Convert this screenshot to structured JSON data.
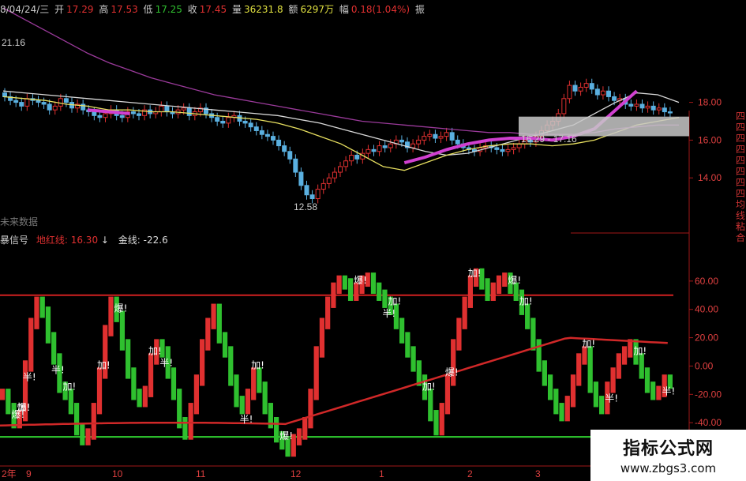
{
  "header": {
    "date": "8/04/24/三",
    "open_label": "开",
    "open": "17.29",
    "high_label": "高",
    "high": "17.53",
    "low_label": "低",
    "low": "17.25",
    "close_label": "收",
    "close": "17.45",
    "vol_label": "量",
    "vol": "36231.8",
    "amt_label": "额",
    "amt": "6297万",
    "chg_label": "幅",
    "chg": "0.18(1.04%)",
    "tail": "振"
  },
  "upper_panel": {
    "price_ticks": [
      "18.00",
      "16.00",
      "14.00"
    ],
    "label_max": "21.16",
    "label_min": "12.58",
    "zone_label": "16.29 - 17.16",
    "future_label": "未来数据"
  },
  "indicator_panel": {
    "name": "暴信号",
    "line1_label": "地红线:",
    "line1_value": "16.30",
    "line1_arrow": "↓",
    "line2_label": "金线:",
    "line2_value": "-22.6",
    "ticks": [
      "60.00",
      "40.00",
      "20.00",
      "0.00",
      "-20.00",
      "-40.00",
      "-60.00"
    ],
    "markers": [
      {
        "text": "爆",
        "x": 3
      },
      {
        "text": "爆",
        "x": 4
      },
      {
        "text": "加",
        "x": 4.8
      },
      {
        "text": "半",
        "x": 6
      },
      {
        "text": "半",
        "x": 13
      },
      {
        "text": "加",
        "x": 16
      },
      {
        "text": "加",
        "x": 25
      },
      {
        "text": "爆",
        "x": 29
      },
      {
        "text": "加",
        "x": 38
      },
      {
        "text": "半",
        "x": 40
      },
      {
        "text": "半",
        "x": 60
      },
      {
        "text": "加",
        "x": 63
      },
      {
        "text": "爆",
        "x": 70
      },
      {
        "text": "爆",
        "x": 90
      },
      {
        "text": "加",
        "x": 98
      },
      {
        "text": "半",
        "x": 97
      },
      {
        "text": "加",
        "x": 107
      },
      {
        "text": "加",
        "x": 118
      },
      {
        "text": "爆",
        "x": 112
      },
      {
        "text": "爆",
        "x": 128
      },
      {
        "text": "加",
        "x": 131
      },
      {
        "text": "加",
        "x": 147
      },
      {
        "text": "半",
        "x": 153
      },
      {
        "text": "加",
        "x": 160
      },
      {
        "text": "半",
        "x": 167
      }
    ]
  },
  "xaxis": {
    "labels": [
      "2年",
      "9",
      "10",
      "11",
      "12",
      "1",
      "2",
      "3"
    ]
  },
  "vertical_side_text": "四四四四四四四四均线粘合",
  "watermark": {
    "line1": "指标公式网",
    "line2": "www.zbgs3.com"
  },
  "colors": {
    "up": "#e03030",
    "down": "#2fc02f",
    "ma_white": "#d8d8d8",
    "ma_yellow": "#e8e060",
    "ma_magenta": "#d040d0",
    "ma_purple": "#9a3a9a",
    "grid_red": "#a01818",
    "tick_red": "#e04040",
    "threshold_red": "#d02020",
    "threshold_green": "#30d030"
  },
  "chart_data": [
    {
      "type": "candlestick",
      "title": "",
      "y_ticks": [
        18,
        16,
        14
      ],
      "ylim": [
        11.5,
        22.5
      ],
      "annotations": [
        {
          "text": "21.16",
          "value": 21.16
        },
        {
          "text": "12.58",
          "value": 12.58
        },
        {
          "text": "16.29 - 17.16",
          "range": [
            16.29,
            17.16
          ]
        }
      ],
      "close": [
        18.3,
        18.1,
        18.0,
        17.8,
        18.2,
        18.1,
        18.0,
        17.9,
        17.6,
        17.8,
        18.2,
        18.0,
        17.7,
        17.9,
        17.6,
        17.5,
        17.3,
        17.2,
        17.4,
        17.6,
        17.3,
        17.2,
        17.5,
        17.4,
        17.3,
        17.6,
        17.4,
        17.5,
        17.8,
        17.5,
        17.4,
        17.6,
        17.7,
        17.3,
        17.5,
        17.7,
        17.4,
        17.2,
        17.0,
        16.9,
        17.2,
        17.3,
        17.0,
        16.9,
        16.7,
        16.5,
        16.3,
        16.2,
        16.0,
        15.7,
        15.4,
        15.0,
        14.3,
        13.6,
        13.1,
        12.9,
        13.4,
        13.7,
        14.0,
        14.3,
        14.6,
        14.9,
        15.2,
        15.0,
        15.3,
        15.5,
        15.4,
        15.7,
        15.6,
        15.8,
        16.0,
        15.9,
        15.6,
        15.8,
        16.0,
        16.2,
        16.3,
        16.1,
        16.2,
        16.4,
        16.0,
        15.8,
        15.6,
        15.5,
        15.4,
        15.6,
        15.7,
        15.6,
        15.5,
        15.4,
        15.5,
        15.6,
        15.8,
        16.0,
        15.9,
        16.2,
        16.5,
        16.8,
        17.0,
        17.4,
        18.2,
        18.9,
        18.6,
        18.8,
        19.0,
        18.7,
        18.4,
        18.6,
        18.3,
        18.1,
        18.2,
        17.9,
        17.8,
        17.9,
        17.7,
        17.8,
        17.6,
        17.7,
        17.5,
        17.45
      ],
      "ma_series": [
        {
          "color": "#d8d8d8",
          "values": [
            18.6,
            18.5,
            18.4,
            18.3,
            18.2,
            18.1,
            18.0,
            17.9,
            17.8,
            17.7,
            17.6,
            17.5,
            17.4,
            17.3,
            17.1,
            16.9,
            16.6,
            16.3,
            16.0,
            15.7,
            15.4,
            15.2,
            15.3,
            15.6,
            15.9,
            16.2,
            16.5,
            16.8,
            17.4,
            18.0,
            18.5,
            18.4,
            18.0
          ]
        },
        {
          "color": "#e8e060",
          "values": [
            18.3,
            18.2,
            18.1,
            17.9,
            17.8,
            17.6,
            17.6,
            17.5,
            17.5,
            17.4,
            17.3,
            17.2,
            17.1,
            16.9,
            16.6,
            16.2,
            15.8,
            15.2,
            14.6,
            14.4,
            14.8,
            15.2,
            15.5,
            15.7,
            15.8,
            15.8,
            15.7,
            15.8,
            16.0,
            16.4,
            16.8,
            17.0,
            17.2
          ]
        },
        {
          "color": "#d040d0",
          "values": [
            null,
            null,
            null,
            null,
            17.6,
            17.5,
            17.4,
            null,
            null,
            null,
            null,
            null,
            null,
            null,
            null,
            null,
            null,
            null,
            null,
            14.8,
            15.1,
            15.5,
            15.8,
            16.0,
            16.1,
            16.1,
            16.0,
            16.2,
            16.6,
            17.6,
            18.6,
            null,
            null
          ]
        },
        {
          "color": "#9a3a9a",
          "values": [
            23.0,
            22.4,
            21.8,
            21.2,
            20.6,
            20.1,
            19.7,
            19.3,
            19.0,
            18.7,
            18.4,
            18.2,
            18.0,
            17.8,
            17.6,
            17.4,
            17.2,
            17.0,
            16.9,
            16.8,
            16.7,
            16.6,
            16.5,
            16.4,
            16.4,
            16.3,
            16.3,
            16.3,
            16.4,
            16.6,
            16.7,
            16.8,
            16.8
          ]
        }
      ]
    },
    {
      "type": "bar",
      "title": "",
      "ylim": [
        -65,
        80
      ],
      "y_ticks": [
        60,
        40,
        20,
        0,
        -20,
        -40,
        -60
      ],
      "thresholds": [
        50,
        -50
      ],
      "values": [
        -20,
        -30,
        -40,
        -35,
        0,
        30,
        45,
        38,
        20,
        5,
        -15,
        -20,
        -30,
        -45,
        -52,
        -48,
        -30,
        -5,
        25,
        45,
        35,
        15,
        -5,
        -20,
        -25,
        -18,
        5,
        15,
        10,
        -5,
        -20,
        -40,
        -48,
        -30,
        -10,
        15,
        30,
        40,
        20,
        10,
        -10,
        -25,
        -30,
        -20,
        -5,
        -15,
        -30,
        -40,
        -50,
        -55,
        -60,
        -52,
        -48,
        -40,
        -20,
        10,
        30,
        45,
        55,
        60,
        58,
        50,
        55,
        60,
        62,
        55,
        50,
        45,
        40,
        30,
        20,
        10,
        0,
        -10,
        -20,
        -35,
        -45,
        -30,
        -10,
        15,
        30,
        45,
        60,
        65,
        58,
        50,
        55,
        60,
        62,
        55,
        50,
        40,
        30,
        15,
        0,
        -10,
        -20,
        -30,
        -35,
        -25,
        -10,
        5,
        10,
        -15,
        -25,
        -30,
        -15,
        -5,
        5,
        10,
        15,
        5,
        -5,
        -15,
        -20,
        -18,
        -10,
        -12
      ]
    }
  ]
}
